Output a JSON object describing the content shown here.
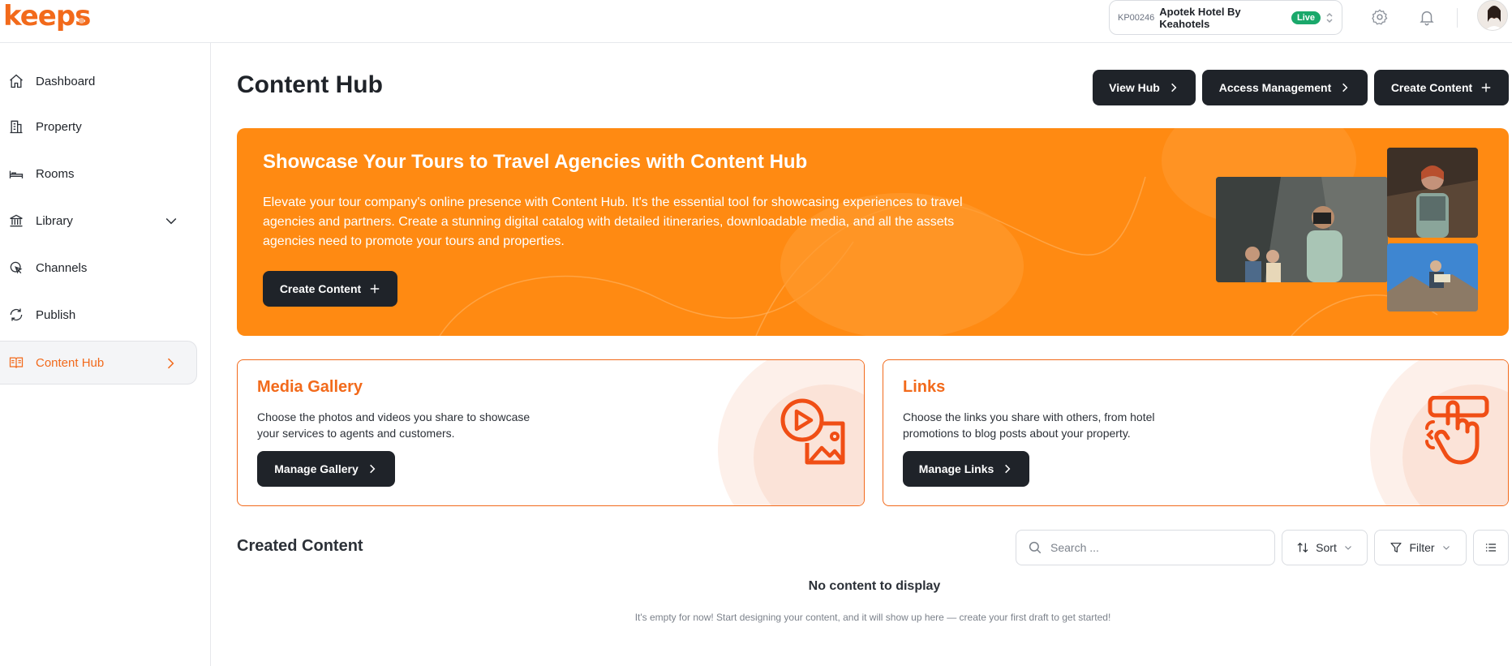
{
  "brand": {
    "logo_text": "keeps",
    "accent": "#f26a1b"
  },
  "header": {
    "property_code": "KP00246",
    "property_name": "Apotek Hotel By Keahotels",
    "status_badge": "Live",
    "icons": [
      "settings-icon",
      "bell-icon"
    ]
  },
  "sidebar": {
    "items": [
      {
        "label": "Dashboard",
        "icon": "home-icon"
      },
      {
        "label": "Property",
        "icon": "building-icon"
      },
      {
        "label": "Rooms",
        "icon": "bed-icon"
      },
      {
        "label": "Library",
        "icon": "library-icon"
      },
      {
        "label": "Channels",
        "icon": "pointer-icon"
      },
      {
        "label": "Publish",
        "icon": "sync-icon"
      },
      {
        "label": "Content Hub",
        "icon": "book-icon"
      }
    ],
    "active": "Content Hub"
  },
  "main": {
    "title": "Content Hub",
    "actions": {
      "view_hub": "View Hub",
      "access_management": "Access Management",
      "create_content": "Create Content"
    },
    "hero": {
      "title": "Showcase Your Tours to Travel Agencies with Content Hub",
      "text": "Elevate your tour company's online presence with Content Hub. It's the essential tool for showcasing experiences to travel agencies and partners. Create a stunning digital catalog with detailed itineraries, downloadable media, and all the assets agencies need to promote your tours and properties.",
      "button": "Create Content",
      "color": "#ff8a12"
    },
    "cards": [
      {
        "title": "Media Gallery",
        "text": "Choose the photos and videos you share to showcase your services to agents and customers.",
        "button": "Manage Gallery",
        "icon": "media-gallery-icon"
      },
      {
        "title": "Links",
        "text": "Choose the links you share with others, from hotel promotions to blog posts about your property.",
        "button": "Manage Links",
        "icon": "link-click-icon"
      }
    ],
    "created_content": {
      "title": "Created Content",
      "search_placeholder": "Search ...",
      "sort_label": "Sort",
      "filter_label": "Filter",
      "empty_title": "No content to display",
      "empty_text": "It's empty for now! Start designing your content, and it will show up here — create your first draft to get started!"
    }
  }
}
